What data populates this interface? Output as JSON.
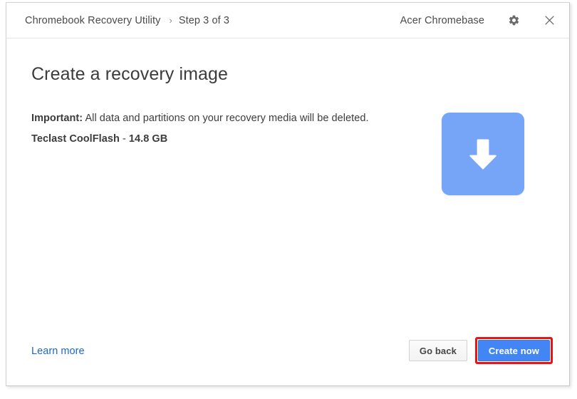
{
  "window": {
    "title_bar": {
      "app_title": "Chromebook Recovery Utility",
      "breadcrumb_separator": "›",
      "step_label": "Step 3 of 3",
      "device_name": "Acer Chromebase",
      "settings_icon": "gear-icon",
      "close_icon": "close-icon"
    }
  },
  "main": {
    "page_title": "Create a recovery image",
    "warning": {
      "label": "Important:",
      "text": " All data and partitions on your recovery media will be deleted."
    },
    "media": {
      "name": "Teclast CoolFlash",
      "separator": " - ",
      "size": "14.8 GB"
    },
    "graphic": {
      "icon": "download-arrow-icon",
      "color": "#76a5f8"
    }
  },
  "footer": {
    "learn_more_label": "Learn more",
    "go_back_label": "Go back",
    "create_now_label": "Create now",
    "create_now_accent": "#4285f4",
    "highlight_color": "#ee1111",
    "link_color": "#1967d2"
  }
}
